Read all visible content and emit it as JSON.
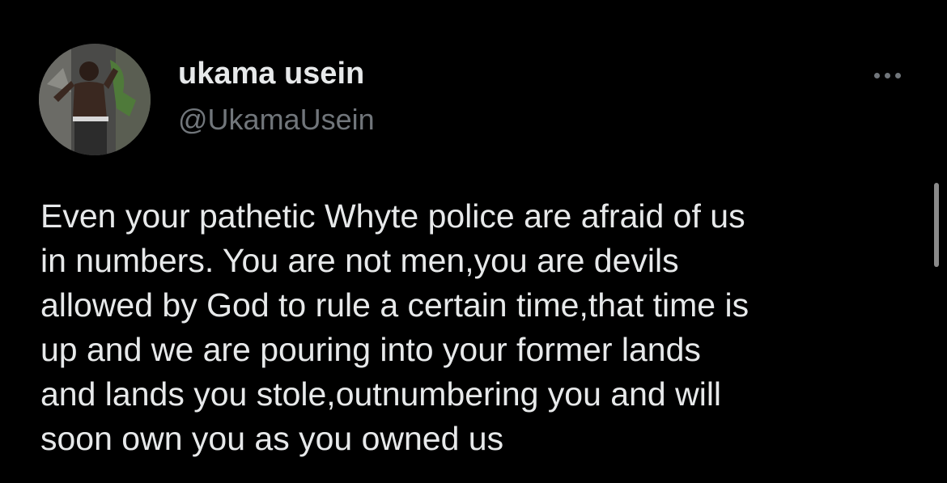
{
  "tweet": {
    "author": {
      "display_name": "ukama usein",
      "handle": "@UkamaUsein",
      "avatar_icon": "profile-photo"
    },
    "more_icon": "more-horizontal-icon",
    "text_lines": [
      "Even your pathetic Whyte police are afraid of us",
      "in numbers. You are not men,you are devils",
      "allowed by God to rule a certain time,that time is",
      "up and we are pouring into your former lands",
      "and lands you stole,outnumbering you and will",
      "soon own you as you owned us"
    ]
  },
  "colors": {
    "background": "#000000",
    "primary_text": "#e7e9ea",
    "secondary_text": "#71767b"
  }
}
